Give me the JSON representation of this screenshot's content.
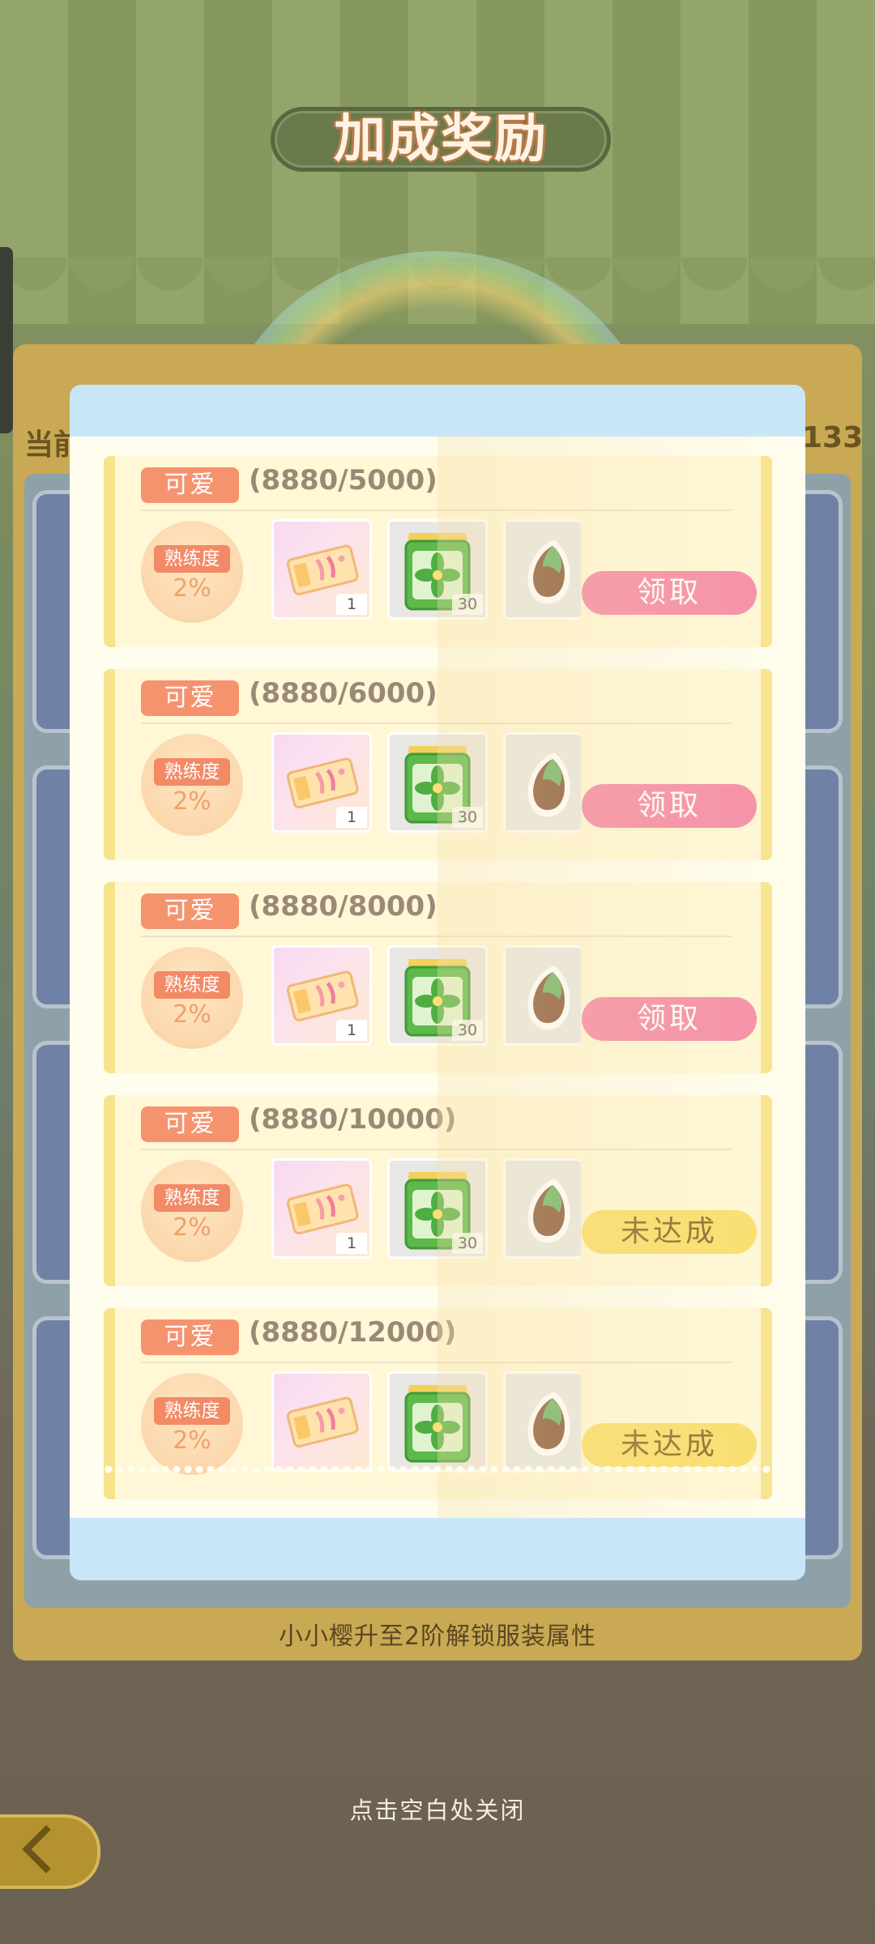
{
  "title": "加成奖励",
  "background": {
    "left_label": "当前",
    "right_number": "133",
    "footer_text": "小小樱升至2阶解锁服装属性"
  },
  "close_hint": "点击空白处关闭",
  "colors": {
    "tag": "#f6936f",
    "claim_button": "#f58aa6",
    "pending_button": "#f9de6a",
    "modal_header": "#c9e6f8",
    "card_border": "#f7e38c"
  },
  "rewards": [
    {
      "tag": "可爱",
      "progress": "(8880/5000)",
      "proficiency_label": "熟练度",
      "proficiency_value": "2%",
      "ticket_count": "1",
      "seed_count": "30",
      "button": "领取",
      "status": "claim"
    },
    {
      "tag": "可爱",
      "progress": "(8880/6000)",
      "proficiency_label": "熟练度",
      "proficiency_value": "2%",
      "ticket_count": "1",
      "seed_count": "30",
      "button": "领取",
      "status": "claim"
    },
    {
      "tag": "可爱",
      "progress": "(8880/8000)",
      "proficiency_label": "熟练度",
      "proficiency_value": "2%",
      "ticket_count": "1",
      "seed_count": "30",
      "button": "领取",
      "status": "claim"
    },
    {
      "tag": "可爱",
      "progress": "(8880/10000)",
      "proficiency_label": "熟练度",
      "proficiency_value": "2%",
      "ticket_count": "1",
      "seed_count": "30",
      "button": "未达成",
      "status": "pending"
    },
    {
      "tag": "可爱",
      "progress": "(8880/12000)",
      "proficiency_label": "熟练度",
      "proficiency_value": "2%",
      "ticket_count": "",
      "seed_count": "",
      "button": "未达成",
      "status": "pending"
    }
  ],
  "icons": {
    "ticket": "ticket-icon",
    "seeds": "seed-packet-icon",
    "sprout": "sprout-seed-icon",
    "back": "back-arrow-icon"
  }
}
